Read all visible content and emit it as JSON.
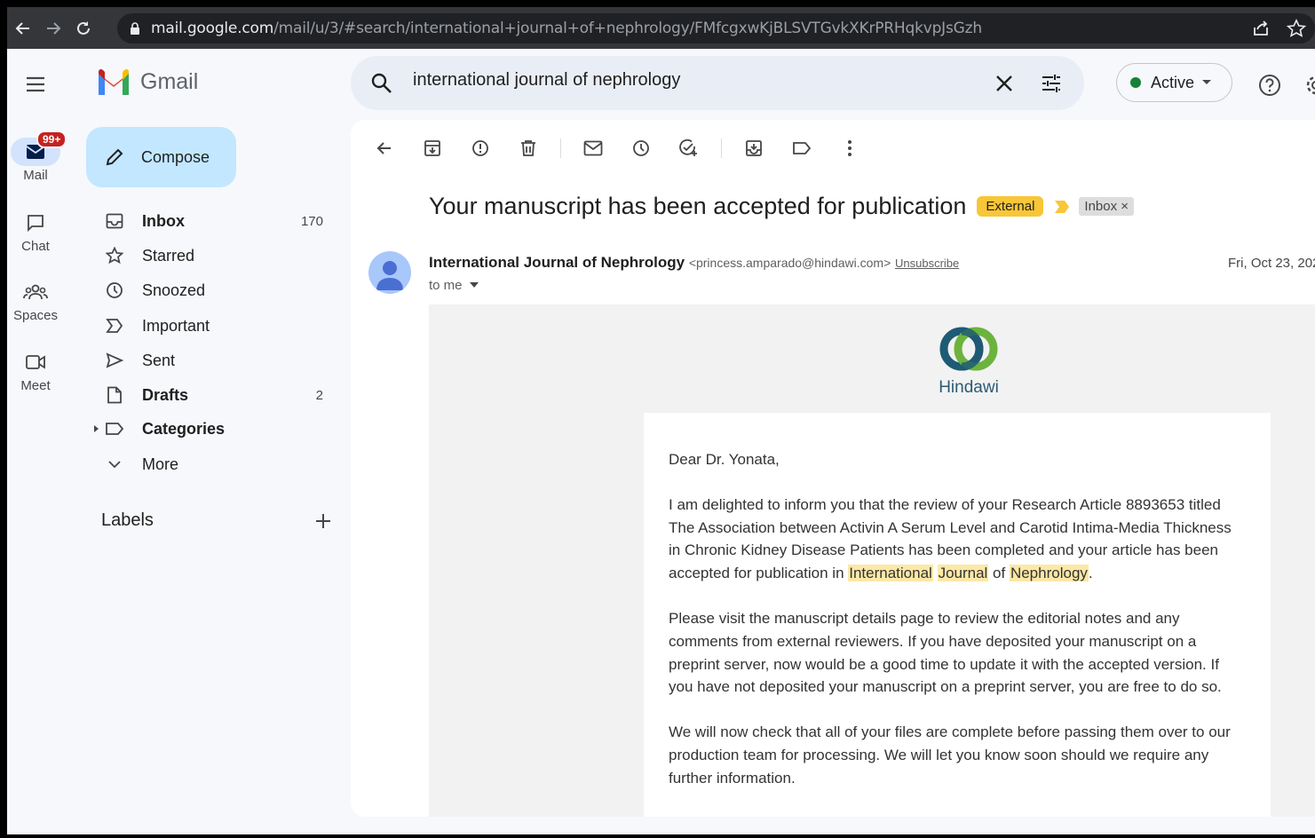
{
  "browser": {
    "url_host": "mail.google.com",
    "url_path": "/mail/u/3/#search/international+journal+of+nephrology/FMfcgxwKjBLSVTGvkXKrPRHqkvpJsGzh"
  },
  "app": {
    "name": "Gmail"
  },
  "rail": {
    "mail_badge": "99+",
    "items": [
      {
        "label": "Mail",
        "icon": "mail-icon"
      },
      {
        "label": "Chat",
        "icon": "chat-icon"
      },
      {
        "label": "Spaces",
        "icon": "spaces-icon"
      },
      {
        "label": "Meet",
        "icon": "meet-icon"
      }
    ]
  },
  "search": {
    "value": "international journal of nephrology"
  },
  "status": {
    "label": "Active",
    "color": "#188038"
  },
  "sidebar": {
    "compose_label": "Compose",
    "items": [
      {
        "label": "Inbox",
        "count": "170",
        "icon": "inbox-icon",
        "bold": true
      },
      {
        "label": "Starred",
        "count": "",
        "icon": "star-icon",
        "bold": false
      },
      {
        "label": "Snoozed",
        "count": "",
        "icon": "clock-icon",
        "bold": false
      },
      {
        "label": "Important",
        "count": "",
        "icon": "important-icon",
        "bold": false
      },
      {
        "label": "Sent",
        "count": "",
        "icon": "send-icon",
        "bold": false
      },
      {
        "label": "Drafts",
        "count": "2",
        "icon": "draft-icon",
        "bold": true
      },
      {
        "label": "Categories",
        "count": "",
        "icon": "label-icon",
        "bold": true
      },
      {
        "label": "More",
        "count": "",
        "icon": "chevron-down-icon",
        "bold": false
      }
    ],
    "labels_title": "Labels"
  },
  "email": {
    "subject": "Your manuscript has been accepted for publication",
    "external_badge": "External",
    "inbox_chip": "Inbox",
    "sender_name": "International Journal of Nephrology",
    "sender_email": "<princess.amparado@hindawi.com>",
    "unsubscribe": "Unsubscribe",
    "date": "Fri, Oct 23, 202",
    "to": "to me",
    "brand": "Hindawi",
    "greeting": "Dear Dr. Yonata,",
    "p1_a": "I am delighted to inform you that the review of your Research Article 8893653 titled The Association between Activin A Serum Level and Carotid Intima-Media Thickness in Chronic Kidney Disease Patients has been completed and your article has been accepted for publication in ",
    "p1_h1": "International",
    "p1_h2": "Journal",
    "p1_of": " of ",
    "p1_h3": "Nephrology",
    "p1_end": ".",
    "p2": "Please visit the manuscript details page to review the editorial notes and any comments from external reviewers. If you have deposited your manuscript on a preprint server, now would be a good time to update it with the accepted version. If you have not deposited your manuscript on a preprint server, you are free to do so.",
    "p3": "We will now check that all of your files are complete before passing them over to our production team for processing. We will let you know soon should we require any further information."
  },
  "colors": {
    "highlight": "#fce8a6",
    "compose_bg": "#c2e7ff",
    "external_badge": "#f8c637"
  }
}
